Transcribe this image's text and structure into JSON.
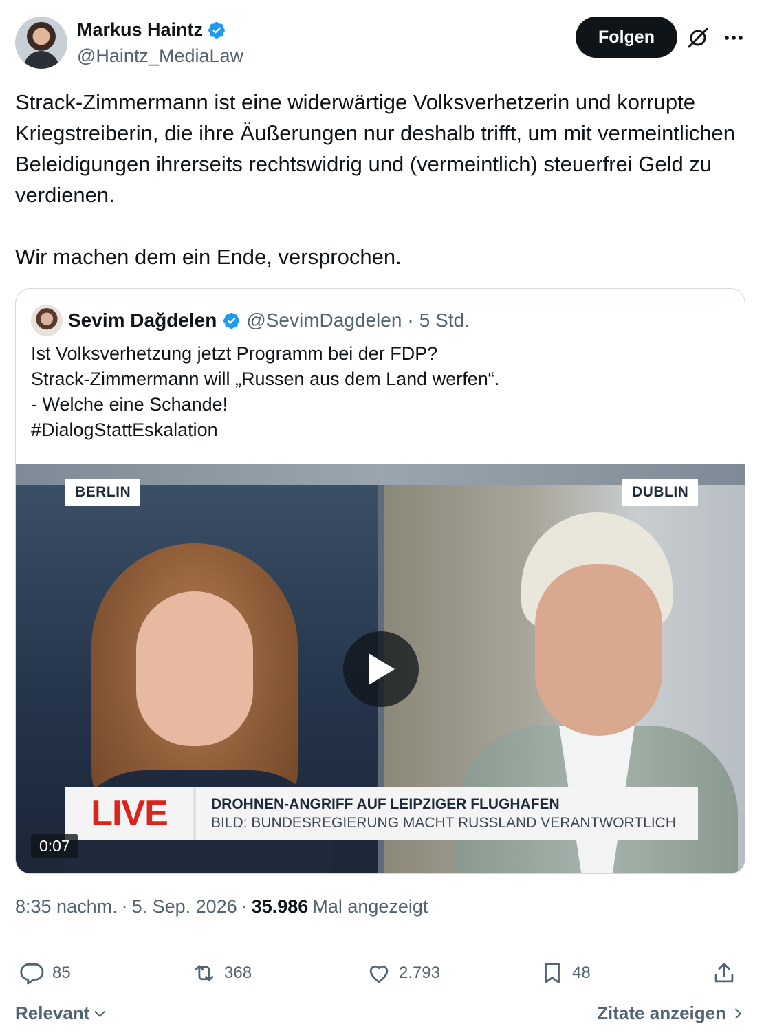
{
  "author": {
    "name": "Markus Haintz",
    "handle": "@Haintz_MediaLaw",
    "verified": true
  },
  "header": {
    "follow_label": "Folgen",
    "icons": [
      "grok-icon",
      "more-icon"
    ]
  },
  "tweet": {
    "text": "Strack-Zimmermann ist eine widerwärtige Volksverhetzerin und korrupte Kriegstreiberin, die ihre Äußerungen nur deshalb trifft, um mit vermeintlichen Beleidigungen ihrerseits rechtswidrig und (vermeintlich) steuerfrei Geld zu verdienen.\n\nWir machen dem ein Ende, versprochen."
  },
  "quote": {
    "name": "Sevim Dağdelen",
    "handle": "@SevimDagdelen",
    "separator": "·",
    "time": "5 Std.",
    "text": "Ist Volksverhetzung jetzt Programm bei der FDP?\nStrack-Zimmermann will „Russen aus dem Land werfen“.\n- Welche eine Schande!\n#DialogStattEskalation",
    "video": {
      "location_left": "BERLIN",
      "location_right": "DUBLIN",
      "live_label": "LIVE",
      "headline": "DROHNEN-ANGRIFF AUF LEIPZIGER FLUGHAFEN",
      "subline": "BILD: BUNDESREGIERUNG MACHT RUSSLAND VERANTWORTLICH",
      "duration": "0:07"
    }
  },
  "meta": {
    "time": "8:35 nachm.",
    "sep1": "·",
    "date": "5. Sep. 2026",
    "sep2": "·",
    "views": "35.986",
    "views_label": "Mal angezeigt"
  },
  "actions": {
    "replies": "85",
    "reposts": "368",
    "likes": "2.793",
    "bookmarks": "48"
  },
  "footer": {
    "sort_label": "Relevant",
    "quotes_label": "Zitate anzeigen"
  },
  "colors": {
    "text": "#0f1419",
    "secondary": "#536471",
    "verified": "#1d9bf0",
    "live_red": "#d9251b"
  }
}
